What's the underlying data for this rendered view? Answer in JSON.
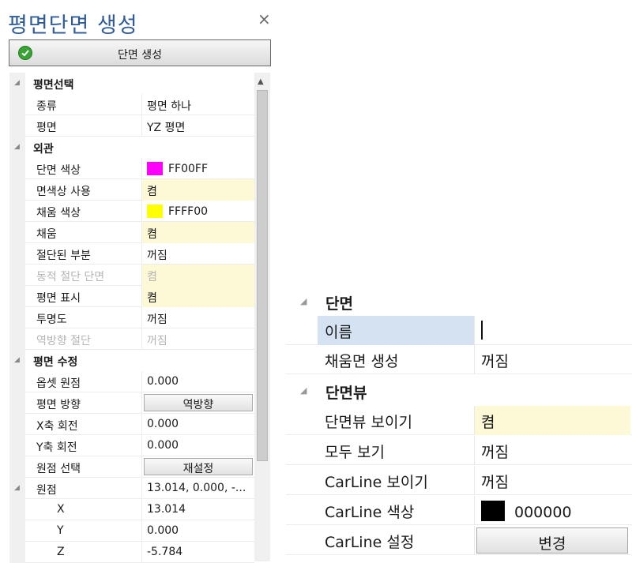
{
  "left_panel": {
    "title": "평면단면 생성",
    "close_glyph": "×",
    "main_button": {
      "label": "단면 생성",
      "icon": "check-circle-icon",
      "icon_color": "#3aa335"
    },
    "categories": {
      "plane_select": "평면선택",
      "appearance": "외관",
      "plane_edit": "평면 수정"
    },
    "props": {
      "kind": {
        "name": "종류",
        "value": "평면 하나"
      },
      "plane": {
        "name": "평면",
        "value": "YZ 평면"
      },
      "section_color": {
        "name": "단면 색상",
        "value": "FF00FF",
        "swatch": "#FF00FF"
      },
      "use_face_color": {
        "name": "면색상 사용",
        "value": "켬"
      },
      "fill_color": {
        "name": "채움 색상",
        "value": "FFFF00",
        "swatch": "#FFFF00"
      },
      "fill": {
        "name": "채움",
        "value": "켬"
      },
      "cut_part": {
        "name": "절단된 부분",
        "value": "꺼짐"
      },
      "dynamic_cut": {
        "name": "동적 절단 단면",
        "value": "켬"
      },
      "show_plane": {
        "name": "평면 표시",
        "value": "켬"
      },
      "transparency": {
        "name": "투명도",
        "value": "꺼짐"
      },
      "reverse_cut": {
        "name": "역방향 절단",
        "value": "꺼짐"
      },
      "offset_origin": {
        "name": "옵셋 원점",
        "value": "0.000"
      },
      "plane_direction": {
        "name": "평면 방향",
        "value": "역방향"
      },
      "x_rotation": {
        "name": "X축 회전",
        "value": "0.000"
      },
      "y_rotation": {
        "name": "Y축 회전",
        "value": "0.000"
      },
      "origin_select": {
        "name": "원점 선택",
        "value": "재설정"
      },
      "origin": {
        "name": "원점",
        "value": "13.014, 0.000, -..."
      },
      "origin_x": {
        "name": "X",
        "value": "13.014"
      },
      "origin_y": {
        "name": "Y",
        "value": "0.000"
      },
      "origin_z": {
        "name": "Z",
        "value": "-5.784"
      }
    }
  },
  "right_panel": {
    "categories": {
      "section": "단면",
      "section_view": "단면뷰"
    },
    "props": {
      "name": {
        "name": "이름",
        "value": ""
      },
      "create_fill_face": {
        "name": "채움면 생성",
        "value": "꺼짐"
      },
      "show_section_view": {
        "name": "단면뷰 보이기",
        "value": "켬"
      },
      "view_all": {
        "name": "모두 보기",
        "value": "꺼짐"
      },
      "show_carline": {
        "name": "CarLine 보이기",
        "value": "꺼짐"
      },
      "carline_color": {
        "name": "CarLine 색상",
        "value": "000000",
        "swatch": "#000000"
      },
      "carline_settings": {
        "name": "CarLine 설정",
        "value": "변경"
      }
    }
  },
  "colors": {
    "title": "#2e5b9a",
    "highlight": "#fdf9d7",
    "selection": "#d5e2f2"
  }
}
